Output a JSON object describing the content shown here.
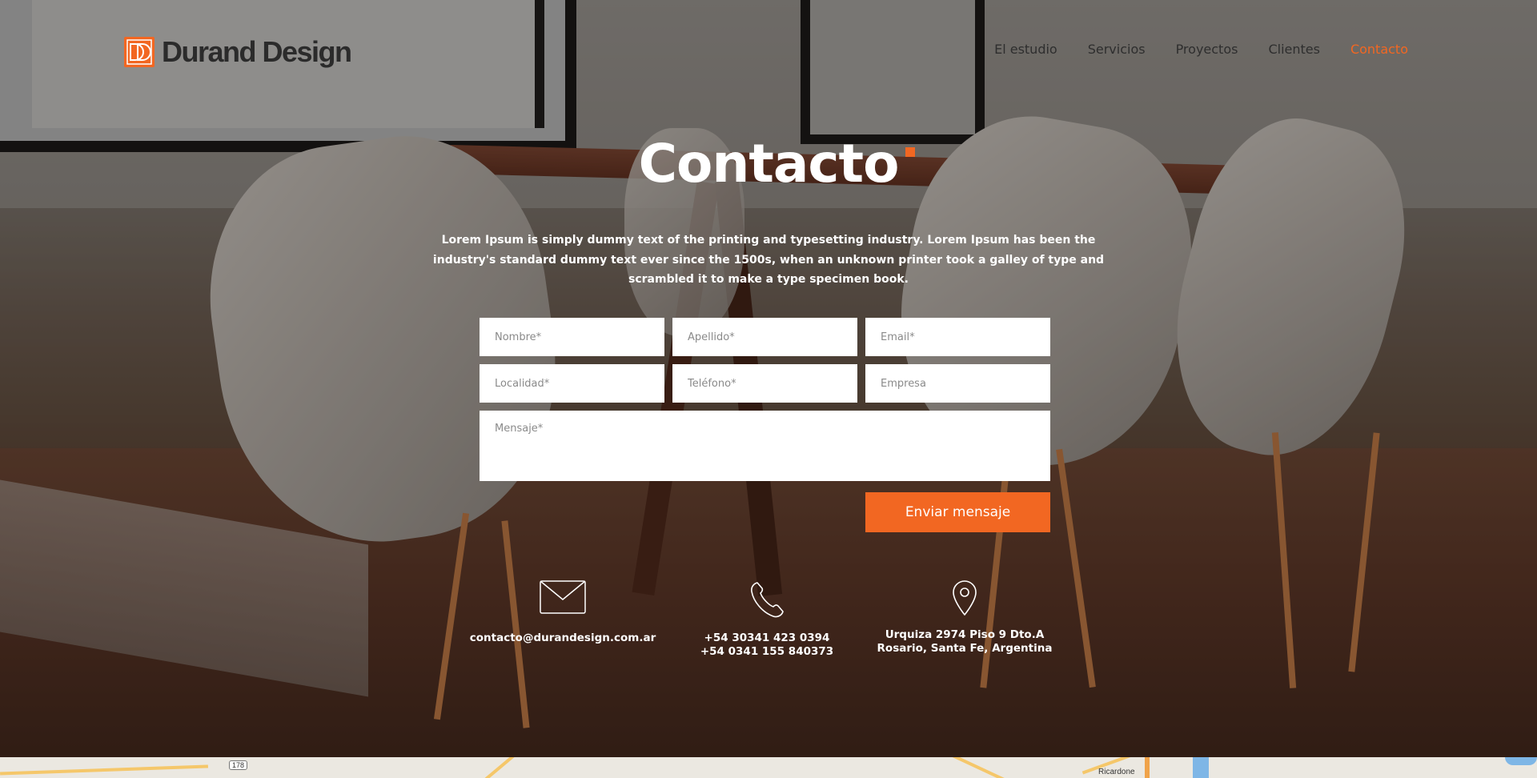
{
  "brand": {
    "name": "Durand Design",
    "accent": "#f26722"
  },
  "nav": {
    "items": [
      {
        "label": "El estudio"
      },
      {
        "label": "Servicios"
      },
      {
        "label": "Proyectos"
      },
      {
        "label": "Clientes"
      },
      {
        "label": "Contacto",
        "active": true
      }
    ]
  },
  "page": {
    "title": "Contacto",
    "intro": "Lorem Ipsum is simply dummy text of the printing and typesetting industry. Lorem Ipsum has been the industry's standard dummy text ever since the 1500s, when an unknown printer took a galley of type and scrambled it to make a type specimen book."
  },
  "form": {
    "nombre_placeholder": "Nombre*",
    "apellido_placeholder": "Apellido*",
    "email_placeholder": "Email*",
    "localidad_placeholder": "Localidad*",
    "telefono_placeholder": "Teléfono*",
    "empresa_placeholder": "Empresa",
    "mensaje_placeholder": "Mensaje*",
    "submit_label": "Enviar mensaje"
  },
  "contact": {
    "email": {
      "icon": "envelope-icon",
      "text": "contacto@durandesign.com.ar"
    },
    "phone": {
      "icon": "phone-icon",
      "line1": "+54 30341 423 0394",
      "line2": "+54 0341 155 840373"
    },
    "address": {
      "icon": "map-pin-icon",
      "line1": "Urquiza 2974 Piso 9 Dto.A",
      "line2": "Rosario, Santa Fe, Argentina"
    }
  },
  "map": {
    "route_badge": "178",
    "place_label": "Ricardone"
  }
}
